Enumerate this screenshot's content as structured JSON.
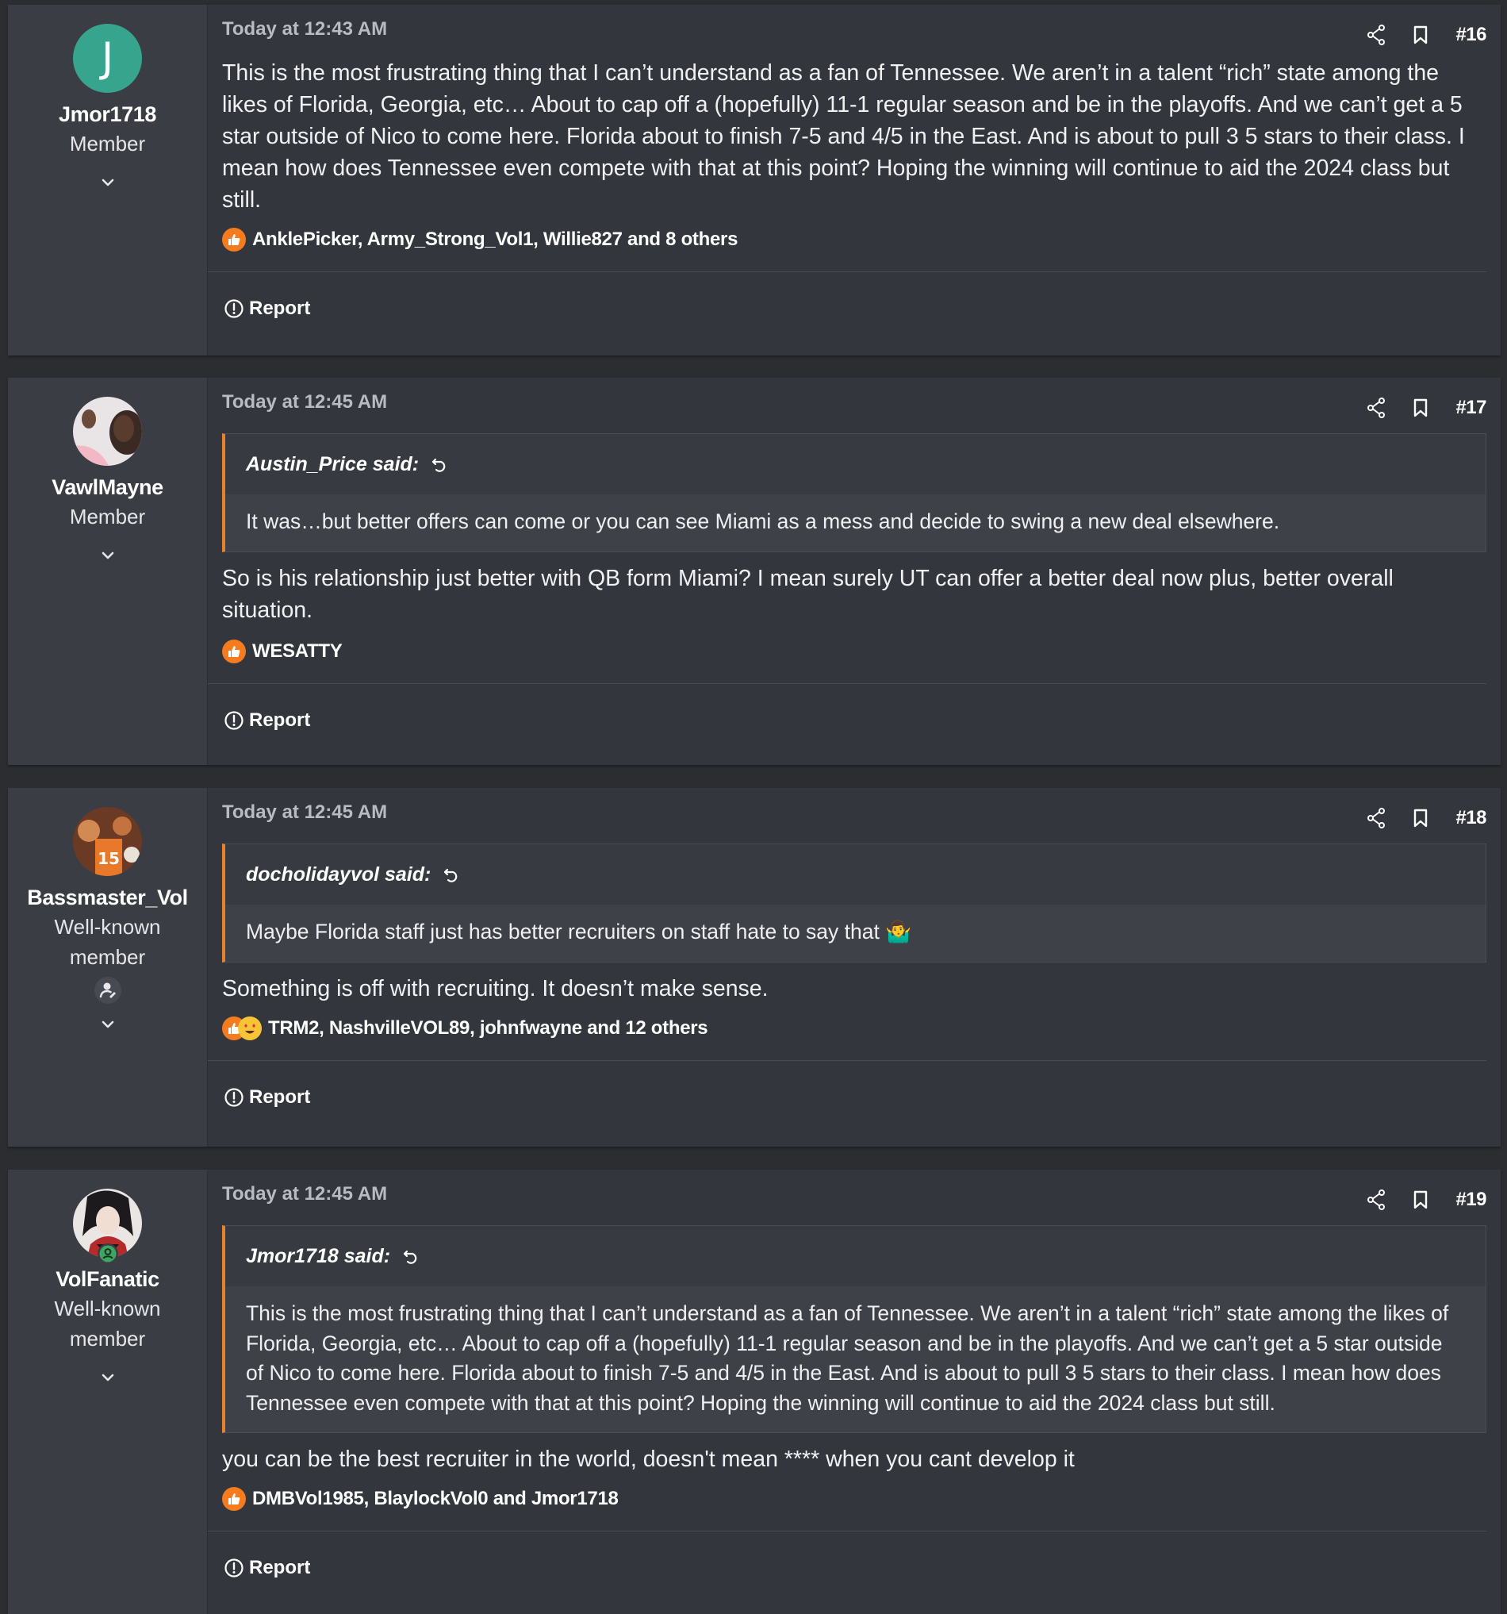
{
  "colors": {
    "page_bg": "#2b2d31",
    "post_bg": "#33363c",
    "user_bg": "#3a3d43",
    "quote_accent": "#e8822a",
    "like": "#f47c1e"
  },
  "posts": [
    {
      "user": {
        "name": "Jmor1718",
        "title": "Member",
        "avatar_letter": "J"
      },
      "date": "Today at 12:43 AM",
      "number": "#16",
      "body": "This is the most frustrating thing that I can’t understand as a fan of Tennessee. We aren’t in a talent “rich” state among the likes of Florida, Georgia, etc… About to cap off a (hopefully) 11-1 regular season and be in the playoffs. And we can’t get a 5 star outside of Nico to come here. Florida about to finish 7-5 and 4/5 in the East. And is about to pull 3 5 stars to their class. I mean how does Tennessee even compete with that at this point? Hoping the winning will continue to aid the 2024 class but still.",
      "reactions": "AnklePicker, Army_Strong_Vol1, Willie827 and 8 others",
      "report": "Report"
    },
    {
      "user": {
        "name": "VawlMayne",
        "title": "Member"
      },
      "date": "Today at 12:45 AM",
      "number": "#17",
      "quote": {
        "author": "Austin_Price said:",
        "text": "It was…but better offers can come or you can see Miami as a mess and decide to swing a new deal elsewhere."
      },
      "body": "So is his relationship just better with QB form Miami? I mean surely UT can offer a better deal now plus, better overall situation.",
      "reactions": "WESATTY",
      "report": "Report"
    },
    {
      "user": {
        "name": "Bassmaster_Vol",
        "title": "Well-known member"
      },
      "date": "Today at 12:45 AM",
      "number": "#18",
      "quote": {
        "author": "docholidayvol said:",
        "text": "Maybe Florida staff just has better recruiters on staff hate to say that 🤷‍♂️"
      },
      "body": "Something is off with recruiting. It doesn’t make sense.",
      "reactions": "TRM2, NashvilleVOL89, johnfwayne and 12 others",
      "report": "Report"
    },
    {
      "user": {
        "name": "VolFanatic",
        "title": "Well-known member"
      },
      "date": "Today at 12:45 AM",
      "number": "#19",
      "quote": {
        "author": "Jmor1718 said:",
        "text": "This is the most frustrating thing that I can’t understand as a fan of Tennessee. We aren’t in a talent “rich” state among the likes of Florida, Georgia, etc… About to cap off a (hopefully) 11-1 regular season and be in the playoffs. And we can’t get a 5 star outside of Nico to come here. Florida about to finish 7-5 and 4/5 in the East. And is about to pull 3 5 stars to their class. I mean how does Tennessee even compete with that at this point? Hoping the winning will continue to aid the 2024 class but still."
      },
      "body": "you can be the best recruiter in the world, doesn't mean **** when you cant develop it",
      "reactions": "DMBVol1985, BlaylockVol0 and Jmor1718",
      "report": "Report"
    }
  ]
}
